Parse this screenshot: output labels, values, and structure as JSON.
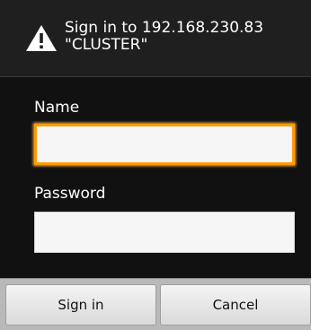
{
  "dialog": {
    "title_line1": "Sign in to 192.168.230.83",
    "title_line2": "\"CLUSTER\"",
    "icon": "warning-icon"
  },
  "form": {
    "name_label": "Name",
    "name_value": "",
    "password_label": "Password",
    "password_value": ""
  },
  "buttons": {
    "sign_in_label": "Sign in",
    "cancel_label": "Cancel"
  },
  "colors": {
    "focus_border": "#ff9a00",
    "dialog_background": "#111111"
  }
}
